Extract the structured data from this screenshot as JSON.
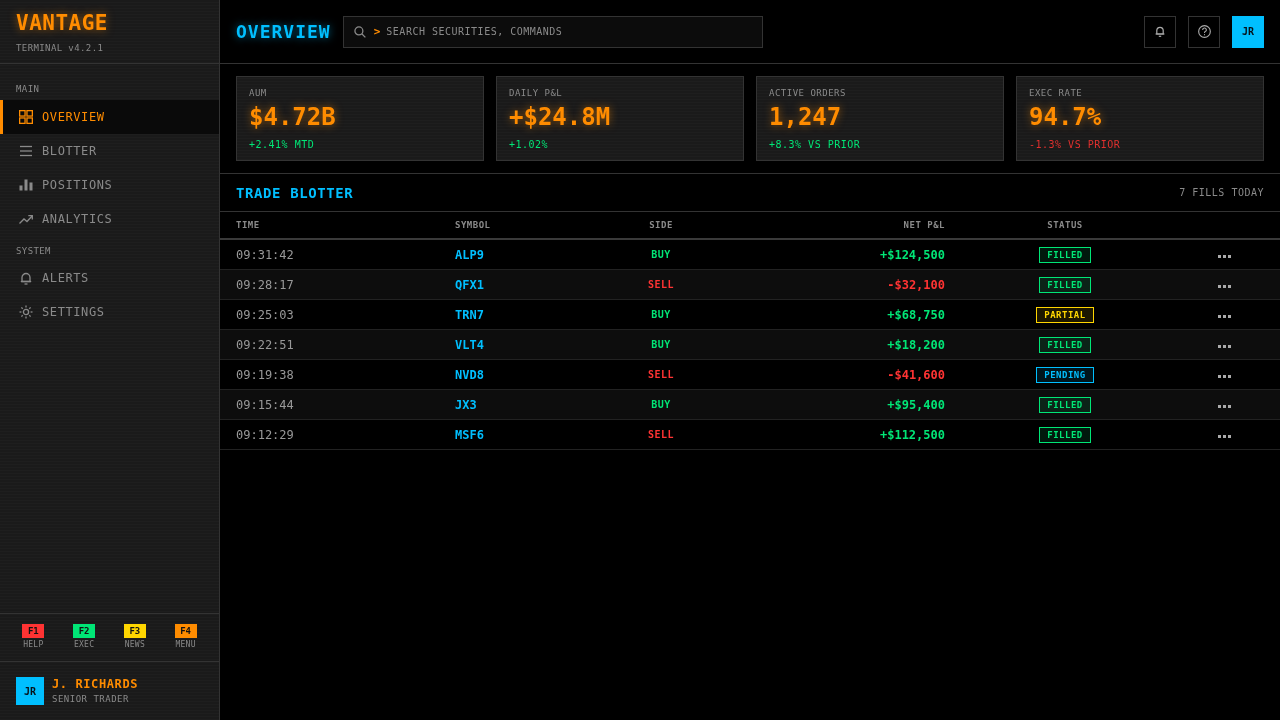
{
  "sidebar": {
    "brand": "VANTAGE",
    "version": "TERMINAL v4.2.1",
    "sections": [
      {
        "title": "MAIN",
        "items": [
          {
            "label": "OVERVIEW",
            "selected": true
          },
          {
            "label": "BLOTTER",
            "selected": false
          },
          {
            "label": "POSITIONS",
            "selected": false
          },
          {
            "label": "ANALYTICS",
            "selected": false
          }
        ]
      },
      {
        "title": "SYSTEM",
        "items": [
          {
            "label": "ALERTS",
            "selected": false
          },
          {
            "label": "SETTINGS",
            "selected": false
          }
        ]
      }
    ],
    "function_keys": [
      {
        "key": "F1",
        "label": "HELP",
        "color": "#ff3333"
      },
      {
        "key": "F2",
        "label": "EXEC",
        "color": "#00e676"
      },
      {
        "key": "F3",
        "label": "NEWS",
        "color": "#ffd600"
      },
      {
        "key": "F4",
        "label": "MENU",
        "color": "#ff8c00"
      }
    ],
    "user": {
      "initials": "JR",
      "name": "J. RICHARDS",
      "role": "SENIOR TRADER"
    }
  },
  "header": {
    "title": "OVERVIEW",
    "search": {
      "prompt": ">",
      "placeholder": "SEARCH SECURITIES, COMMANDS"
    },
    "avatar": "JR"
  },
  "metrics": [
    {
      "label": "AUM",
      "value": "$4.72B",
      "change": "+2.41% MTD",
      "negative": false
    },
    {
      "label": "DAILY P&L",
      "value": "+$24.8M",
      "change": "+1.02%",
      "negative": false
    },
    {
      "label": "ACTIVE ORDERS",
      "value": "1,247",
      "change": "+8.3% VS PRIOR",
      "negative": false
    },
    {
      "label": "EXEC RATE",
      "value": "94.7%",
      "change": "-1.3% VS PRIOR",
      "negative": true
    }
  ],
  "blotter": {
    "title": "TRADE BLOTTER",
    "count": "7 FILLS TODAY",
    "columns": [
      "TIME",
      "SYMBOL",
      "SIDE",
      "NET P&L",
      "STATUS"
    ],
    "rows": [
      {
        "time": "09:31:42",
        "symbol": "ALP9",
        "side": {
          "label": "BUY",
          "kind": "buy"
        },
        "net_pnl": {
          "value": "+$124,500",
          "negative": false
        },
        "status": {
          "label": "FILLED",
          "color": "#00e676"
        }
      },
      {
        "time": "09:28:17",
        "symbol": "QFX1",
        "side": {
          "label": "SELL",
          "kind": "sell"
        },
        "net_pnl": {
          "value": "-$32,100",
          "negative": true
        },
        "status": {
          "label": "FILLED",
          "color": "#00e676"
        }
      },
      {
        "time": "09:25:03",
        "symbol": "TRN7",
        "side": {
          "label": "BUY",
          "kind": "buy"
        },
        "net_pnl": {
          "value": "+$68,750",
          "negative": false
        },
        "status": {
          "label": "PARTIAL",
          "color": "#ffd600"
        }
      },
      {
        "time": "09:22:51",
        "symbol": "VLT4",
        "side": {
          "label": "BUY",
          "kind": "buy"
        },
        "net_pnl": {
          "value": "+$18,200",
          "negative": false
        },
        "status": {
          "label": "FILLED",
          "color": "#00e676"
        }
      },
      {
        "time": "09:19:38",
        "symbol": "NVD8",
        "side": {
          "label": "SELL",
          "kind": "sell"
        },
        "net_pnl": {
          "value": "-$41,600",
          "negative": true
        },
        "status": {
          "label": "PENDING",
          "color": "#00bfff"
        }
      },
      {
        "time": "09:15:44",
        "symbol": "JX3",
        "side": {
          "label": "BUY",
          "kind": "buy"
        },
        "net_pnl": {
          "value": "+$95,400",
          "negative": false
        },
        "status": {
          "label": "FILLED",
          "color": "#00e676"
        }
      },
      {
        "time": "09:12:29",
        "symbol": "MSF6",
        "side": {
          "label": "SELL",
          "kind": "sell"
        },
        "net_pnl": {
          "value": "+$112,500",
          "negative": false
        },
        "status": {
          "label": "FILLED",
          "color": "#00e676"
        }
      }
    ]
  }
}
